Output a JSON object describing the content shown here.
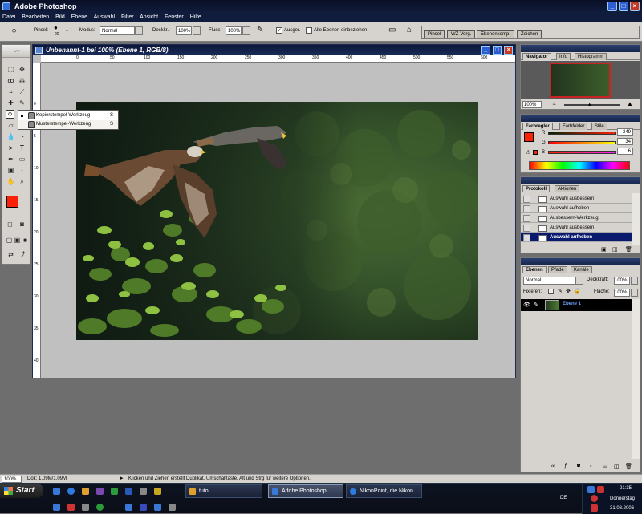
{
  "app": {
    "title": "Adobe Photoshop"
  },
  "menu": [
    "Datei",
    "Bearbeiten",
    "Bild",
    "Ebene",
    "Auswahl",
    "Filter",
    "Ansicht",
    "Fenster",
    "Hilfe"
  ],
  "options": {
    "brush_label": "Pinsel:",
    "brush_size": "20",
    "mode_label": "Modus:",
    "mode_value": "Normal",
    "opacity_label": "Deckkr.:",
    "opacity_value": "100%",
    "flow_label": "Fluss:",
    "flow_value": "100%",
    "aligned_label": "Ausger.",
    "all_layers_label": "Alle Ebenen einbeziehen"
  },
  "palette_well": [
    "Pinsel",
    "WZ-Vorg.",
    "Ebenenkomp.",
    "Zeichen"
  ],
  "tool_flyout": [
    {
      "label": "Kopierstempel-Werkzeug",
      "shortcut": "S"
    },
    {
      "label": "Musterstempel-Werkzeug",
      "shortcut": "S"
    }
  ],
  "document": {
    "title": "Unbenannt-1 bei 100% (Ebene 1, RGB/8)",
    "ruler_h": [
      "0",
      "50",
      "100",
      "150",
      "200",
      "250",
      "300",
      "350",
      "400",
      "450",
      "500",
      "550",
      "600"
    ],
    "ruler_v": [
      "0",
      "5",
      "10",
      "15",
      "20",
      "25",
      "30",
      "35",
      "40"
    ]
  },
  "navigator": {
    "tabs": [
      "Navigator",
      "Info",
      "Histogramm"
    ],
    "zoom": "100%"
  },
  "color": {
    "tabs": [
      "Farbregler",
      "Farbfelder",
      "Stile"
    ],
    "r_label": "R",
    "g_label": "G",
    "b_label": "B",
    "r": "249",
    "g": "34",
    "b": "6",
    "foreground": "#f92206",
    "background": "#000000"
  },
  "history": {
    "tabs": [
      "Protokoll",
      "Aktionen"
    ],
    "items": [
      "Auswahl ausbessern",
      "Auswahl aufheben",
      "Ausbessern-Werkzeug",
      "Auswahl ausbessern",
      "Auswahl aufheben"
    ]
  },
  "layers": {
    "tabs": [
      "Ebenen",
      "Pfade",
      "Kanäle"
    ],
    "blend_mode": "Normal",
    "opacity_label": "Deckkraft:",
    "opacity": "100%",
    "lock_label": "Fixieren:",
    "fill_label": "Fläche:",
    "fill": "100%",
    "layer_name": "Ebene 1"
  },
  "status": {
    "zoom": "100%",
    "doc": "Dok: 1,09M/1,09M",
    "hint": "Klicken und Ziehen erstellt Duplikat. Umschalttaste, Alt und Strg für weitere Optionen."
  },
  "taskbar": {
    "start": "Start",
    "tasks": [
      "tuto",
      "Adobe Photoshop",
      "NikonPoint, die Nikon ..."
    ],
    "lang": "DE",
    "time": "21:35",
    "day": "Donnerstag",
    "date": "31.08.2006"
  }
}
